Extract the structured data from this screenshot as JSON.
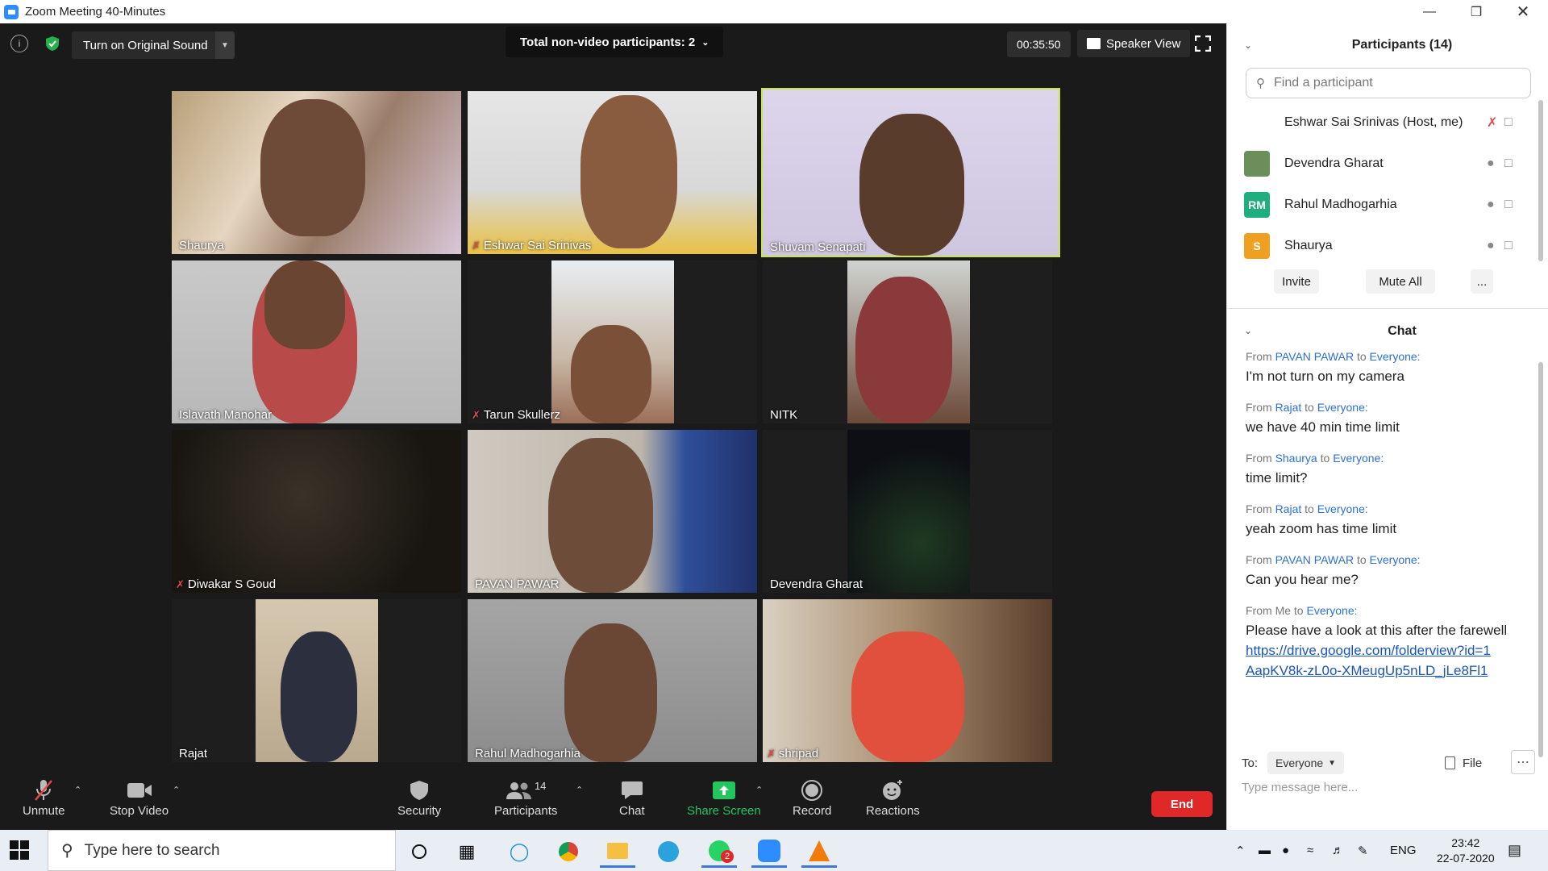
{
  "window": {
    "title": "Zoom Meeting 40-Minutes"
  },
  "meeting": {
    "original_sound_label": "Turn on Original Sound",
    "nonvideo_label": "Total non-video participants: 2",
    "timer": "00:35:50",
    "speaker_view_label": "Speaker View"
  },
  "tiles": [
    {
      "name": "Shaurya",
      "muted": false
    },
    {
      "name": "Eshwar Sai Srinivas",
      "muted": true
    },
    {
      "name": "Shuvam Senapati",
      "muted": false
    },
    {
      "name": "Islavath Manohar",
      "muted": false
    },
    {
      "name": "Tarun Skullerz",
      "muted": true
    },
    {
      "name": "NITK",
      "muted": false
    },
    {
      "name": "Diwakar S Goud",
      "muted": true
    },
    {
      "name": "PAVAN PAWAR",
      "muted": false
    },
    {
      "name": "Devendra Gharat",
      "muted": false
    },
    {
      "name": "Rajat",
      "muted": false
    },
    {
      "name": "Rahul Madhogarhia",
      "muted": false
    },
    {
      "name": "shripad",
      "muted": true
    }
  ],
  "toolbar": {
    "unmute": "Unmute",
    "stop_video": "Stop Video",
    "security": "Security",
    "participants": "Participants",
    "participants_count": "14",
    "chat": "Chat",
    "share_screen": "Share Screen",
    "record": "Record",
    "reactions": "Reactions",
    "end": "End"
  },
  "panel": {
    "participants_title": "Participants (14)",
    "find_placeholder": "Find a participant",
    "participants": [
      {
        "name": "Eshwar Sai Srinivas (Host, me)",
        "initials": "",
        "color": "#ffffff"
      },
      {
        "name": "Devendra Gharat",
        "initials": "",
        "color": "#6b8e5a"
      },
      {
        "name": "Rahul Madhogarhia",
        "initials": "RM",
        "color": "#1fae7e"
      },
      {
        "name": "Shaurya",
        "initials": "S",
        "color": "#f0a020"
      }
    ],
    "invite": "Invite",
    "mute_all": "Mute All",
    "more": "...",
    "chat_title": "Chat",
    "messages": [
      {
        "from": "PAVAN PAWAR",
        "to": "Everyone:",
        "text": "I'm not turn on my camera"
      },
      {
        "from": "Rajat",
        "to": "Everyone:",
        "text": "we have 40 min time limit"
      },
      {
        "from": "Shaurya",
        "to": "Everyone:",
        "text": "time limit?"
      },
      {
        "from": "Rajat",
        "to": "Everyone:",
        "text": "yeah zoom has time limit"
      },
      {
        "from": "PAVAN PAWAR",
        "to": "Everyone:",
        "text": "Can you hear me?"
      },
      {
        "from": "Me",
        "to": "Everyone:",
        "text": "Please have a look at this after the farewell",
        "link": "https://drive.google.com/folderview?id=1AapKV8k-zL0o-XMeugUp5nLD_jLe8Fl1"
      }
    ],
    "from_word": "From",
    "to_word": "to",
    "to_label": "To:",
    "to_value": "Everyone",
    "file_label": "File",
    "message_placeholder": "Type message here..."
  },
  "taskbar": {
    "search_placeholder": "Type here to search",
    "whatsapp_badge": "2",
    "language": "ENG",
    "time": "23:42",
    "date": "22-07-2020"
  },
  "colors": {
    "accent": "#2d8cff",
    "end": "#e02828",
    "share": "#22c55e",
    "active_speaker": "#c8e64c",
    "muted": "#e04a4a"
  }
}
